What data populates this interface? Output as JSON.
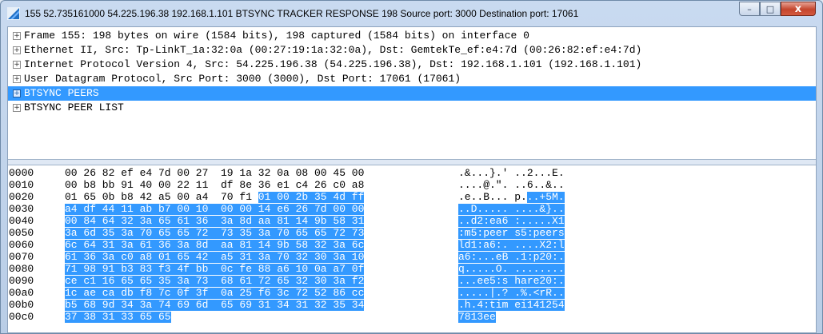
{
  "window": {
    "title": "155 52.735161000 54.225.196.38 192.168.1.101 BTSYNC TRACKER RESPONSE 198 Source port: 3000  Destination port: 17061",
    "minimize": "–",
    "maximize": "□",
    "close": "x"
  },
  "tree": [
    {
      "text": "Frame 155: 198 bytes on wire (1584 bits), 198 captured (1584 bits) on interface 0",
      "selected": false
    },
    {
      "text": "Ethernet II, Src: Tp-LinkT_1a:32:0a (00:27:19:1a:32:0a), Dst: GemtekTe_ef:e4:7d (00:26:82:ef:e4:7d)",
      "selected": false
    },
    {
      "text": "Internet Protocol Version 4, Src: 54.225.196.38 (54.225.196.38), Dst: 192.168.1.101 (192.168.1.101)",
      "selected": false
    },
    {
      "text": "User Datagram Protocol, Src Port: 3000 (3000), Dst Port: 17061 (17061)",
      "selected": false
    },
    {
      "text": "BTSYNC PEERS",
      "selected": true
    },
    {
      "text": "BTSYNC PEER LIST",
      "selected": false
    }
  ],
  "hex_rows": [
    {
      "offset": "0000",
      "bytes": [
        "00",
        "26",
        "82",
        "ef",
        "e4",
        "7d",
        "00",
        "27",
        "19",
        "1a",
        "32",
        "0a",
        "08",
        "00",
        "45",
        "00"
      ],
      "ascii": ".&...}.' ..2...E."
    },
    {
      "offset": "0010",
      "bytes": [
        "00",
        "b8",
        "bb",
        "91",
        "40",
        "00",
        "22",
        "11",
        "df",
        "8e",
        "36",
        "e1",
        "c4",
        "26",
        "c0",
        "a8"
      ],
      "ascii": "....@.\". ..6..&.."
    },
    {
      "offset": "0020",
      "bytes": [
        "01",
        "65",
        "0b",
        "b8",
        "42",
        "a5",
        "00",
        "a4",
        "70",
        "f1",
        "01",
        "00",
        "2b",
        "35",
        "4d",
        "ff"
      ],
      "ascii": ".e..B... p...+5M."
    },
    {
      "offset": "0030",
      "bytes": [
        "a4",
        "df",
        "44",
        "11",
        "ab",
        "b7",
        "00",
        "10",
        "00",
        "00",
        "14",
        "e6",
        "26",
        "7d",
        "00",
        "00"
      ],
      "ascii": "..D..... ....&}.."
    },
    {
      "offset": "0040",
      "bytes": [
        "00",
        "84",
        "64",
        "32",
        "3a",
        "65",
        "61",
        "36",
        "3a",
        "8d",
        "aa",
        "81",
        "14",
        "9b",
        "58",
        "31"
      ],
      "ascii": "..d2:ea6 :.....X1"
    },
    {
      "offset": "0050",
      "bytes": [
        "3a",
        "6d",
        "35",
        "3a",
        "70",
        "65",
        "65",
        "72",
        "73",
        "35",
        "3a",
        "70",
        "65",
        "65",
        "72",
        "73"
      ],
      "ascii": ":m5:peer s5:peers"
    },
    {
      "offset": "0060",
      "bytes": [
        "6c",
        "64",
        "31",
        "3a",
        "61",
        "36",
        "3a",
        "8d",
        "aa",
        "81",
        "14",
        "9b",
        "58",
        "32",
        "3a",
        "6c"
      ],
      "ascii": "ld1:a6:. ....X2:l"
    },
    {
      "offset": "0070",
      "bytes": [
        "61",
        "36",
        "3a",
        "c0",
        "a8",
        "01",
        "65",
        "42",
        "a5",
        "31",
        "3a",
        "70",
        "32",
        "30",
        "3a",
        "10"
      ],
      "ascii": "a6:...eB .1:p20:."
    },
    {
      "offset": "0080",
      "bytes": [
        "71",
        "98",
        "91",
        "b3",
        "83",
        "f3",
        "4f",
        "bb",
        "0c",
        "fe",
        "88",
        "a6",
        "10",
        "0a",
        "a7",
        "0f"
      ],
      "ascii": "q.....O. ........"
    },
    {
      "offset": "0090",
      "bytes": [
        "ce",
        "c1",
        "16",
        "65",
        "65",
        "35",
        "3a",
        "73",
        "68",
        "61",
        "72",
        "65",
        "32",
        "30",
        "3a",
        "f2"
      ],
      "ascii": "...ee5:s hare20:."
    },
    {
      "offset": "00a0",
      "bytes": [
        "1c",
        "ae",
        "ca",
        "db",
        "f8",
        "7c",
        "0f",
        "3f",
        "0a",
        "25",
        "f6",
        "3c",
        "72",
        "52",
        "86",
        "cc"
      ],
      "ascii": ".....|.? .%.<rR.."
    },
    {
      "offset": "00b0",
      "bytes": [
        "b5",
        "68",
        "9d",
        "34",
        "3a",
        "74",
        "69",
        "6d",
        "65",
        "69",
        "31",
        "34",
        "31",
        "32",
        "35",
        "34"
      ],
      "ascii": ".h.4:tim ei141254"
    },
    {
      "offset": "00c0",
      "bytes": [
        "37",
        "38",
        "31",
        "33",
        "65",
        "65"
      ],
      "ascii": "7813ee"
    }
  ],
  "highlight_start_byte": 42
}
